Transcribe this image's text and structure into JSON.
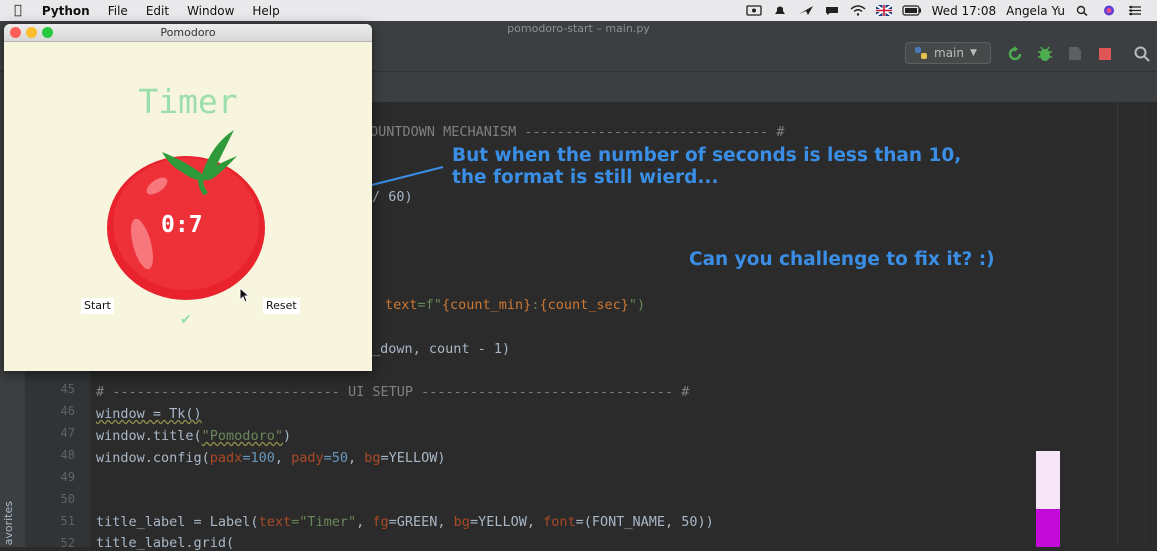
{
  "menubar": {
    "app": "Python",
    "items": [
      "File",
      "Edit",
      "Window",
      "Help"
    ],
    "clock": "Wed 17:08",
    "user": "Angela Yu"
  },
  "ide": {
    "window_title": "pomodoro-start – main.py",
    "branch": "main",
    "favorites_label": "avorites",
    "line_numbers": [
      "45",
      "46",
      "47",
      "48",
      "49",
      "50",
      "51",
      "52"
    ],
    "code": {
      "countdown_comment": "OUNTDOWN MECHANISM ------------------------------ #",
      "div60": "/ 60)",
      "config_kw": "text",
      "config_str_a": "=f\"",
      "config_var1": "{count_min}",
      "config_colon": ":",
      "config_var2": "{count_sec}",
      "config_end": "\")",
      "after_call": "_down, count - 1)",
      "ui_comment": "# ---------------------------- UI SETUP ------------------------------- #",
      "l46": "window = Tk()",
      "l47_a": "window.title(",
      "l47_s": "\"Pomodoro\"",
      "l47_b": ")",
      "l48_a": "window.config(",
      "l48_p1": "padx",
      "l48_v1": "=100",
      "l48_c1": ", ",
      "l48_p2": "pady",
      "l48_v2": "=50",
      "l48_c2": ", ",
      "l48_p3": "bg",
      "l48_end": "=YELLOW)",
      "l51_a": "title_label = Label(",
      "l51_p1": "text",
      "l51_s": "=\"Timer\"",
      "l51_c1": ", ",
      "l51_p2": "fg",
      "l51_v2": "=GREEN, ",
      "l51_p3": "bg",
      "l51_v3": "=YELLOW, ",
      "l51_p4": "font",
      "l51_end": "=(FONT_NAME, 50))",
      "l52": "title_label.grid("
    }
  },
  "annotations": {
    "line1": "But when the number of seconds is less than 10,",
    "line2": "the format is still wierd...",
    "line3": "Can you challenge to fix it? :)",
    "color": "#3a8ee6"
  },
  "pomodoro": {
    "window_title": "Pomodoro",
    "title": "Timer",
    "count": "0:7",
    "start_label": "Start",
    "reset_label": "Reset",
    "checkmark": "✔",
    "colors": {
      "yellow": "#f7f5dd",
      "green": "#9bdeac",
      "red": "#e7305b"
    }
  }
}
